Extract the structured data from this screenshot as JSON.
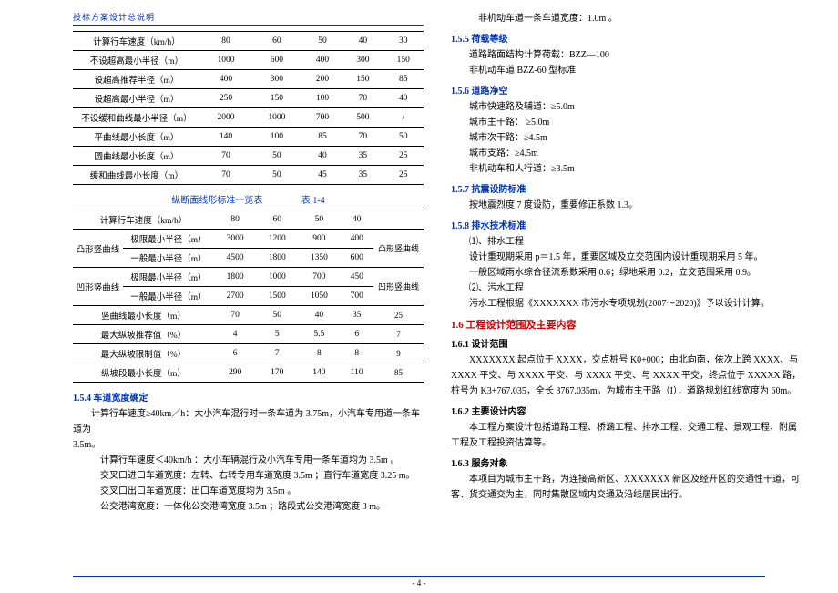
{
  "header": "投标方案设计总说明",
  "table1": {
    "rows": [
      {
        "label": "计算行车速度（km/h）",
        "c": [
          "80",
          "60",
          "50",
          "40",
          "30"
        ]
      },
      {
        "label": "不设超高最小半径（m）",
        "c": [
          "1000",
          "600",
          "400",
          "300",
          "150"
        ]
      },
      {
        "label": "设超高推荐半径（m）",
        "c": [
          "400",
          "300",
          "200",
          "150",
          "85"
        ]
      },
      {
        "label": "设超高最小半径（m）",
        "c": [
          "250",
          "150",
          "100",
          "70",
          "40"
        ]
      },
      {
        "label": "不设缓和曲线最小半径（m）",
        "c": [
          "2000",
          "1000",
          "700",
          "500",
          "/"
        ]
      },
      {
        "label": "平曲线最小长度（m）",
        "c": [
          "140",
          "100",
          "85",
          "70",
          "50"
        ]
      },
      {
        "label": "圆曲线最小长度（m）",
        "c": [
          "70",
          "50",
          "40",
          "35",
          "25"
        ]
      },
      {
        "label": "缓和曲线最小长度（m）",
        "c": [
          "70",
          "50",
          "45",
          "35",
          "25"
        ]
      }
    ]
  },
  "table2": {
    "caption": "纵断面线形标准一览表",
    "tnum": "表 1-4",
    "header": {
      "label": "计算行车速度（km/h）",
      "c": [
        "80",
        "60",
        "50",
        "40"
      ],
      "note": ""
    },
    "groups": [
      {
        "glabel": "凸形竖曲线",
        "rows": [
          {
            "label": "极限最小半径（m）",
            "c": [
              "3000",
              "1200",
              "900",
              "400"
            ],
            "note": "凸形竖曲线"
          },
          {
            "label": "一般最小半径（m）",
            "c": [
              "4500",
              "1800",
              "1350",
              "600"
            ],
            "note": ""
          }
        ]
      },
      {
        "glabel": "凹形竖曲线",
        "rows": [
          {
            "label": "极限最小半径（m）",
            "c": [
              "1800",
              "1000",
              "700",
              "450"
            ],
            "note": "凹形竖曲线"
          },
          {
            "label": "一般最小半径（m）",
            "c": [
              "2700",
              "1500",
              "1050",
              "700"
            ],
            "note": ""
          }
        ]
      }
    ],
    "tail": [
      {
        "label": "竖曲线最小长度（m）",
        "c": [
          "70",
          "50",
          "40",
          "35"
        ],
        "note": "25"
      },
      {
        "label": "最大纵坡推荐值（%）",
        "c": [
          "4",
          "5",
          "5.5",
          "6"
        ],
        "note": "7"
      },
      {
        "label": "最大纵坡限制值（%）",
        "c": [
          "6",
          "7",
          "8",
          "8"
        ],
        "note": "9"
      },
      {
        "label": "纵坡段最小长度（m）",
        "c": [
          "290",
          "170",
          "140",
          "110"
        ],
        "note": "85"
      }
    ]
  },
  "s154": {
    "title": "1.5.4 车道宽度确定",
    "p1": "计算行车速度≥40km／h：大小汽车混行时一条车道为 3.75m，小汽车专用道一条车道为",
    "p1b": "3.5m。",
    "p2": "计算行车速度＜40km/h ：大小车辆混行及小汽车专用一条车道均为 3.5m 。",
    "p3": "交叉口进口车道宽度：左转、右转专用车道宽度 3.5m ；直行车道宽度 3.25 m。",
    "p4": "交叉口出口车道宽度：出口车道宽度均为 3.5m 。",
    "p5": "公交港湾宽度：一体化公交港湾宽度 3.5m ；路段式公交港湾宽度 3 m。",
    "p6": "非机动车道一条车道宽度：1.0m 。"
  },
  "s155": {
    "title": "1.5.5 荷载等级",
    "p1": "道路路面结构计算荷载：BZZ—100",
    "p2": "非机动车道 BZZ-60 型标准"
  },
  "s156": {
    "title": "1.5.6 道路净空",
    "p1": "城市快速路及辅道：≥5.0m",
    "p2": "城市主干路：    ≥5.0m",
    "p3": "城市次干路：≥4.5m",
    "p4": "城市支路：≥4.5m",
    "p5": "非机动车和人行道：≥3.5m"
  },
  "s157": {
    "title": "1.5.7 抗震设防标准",
    "p1": "按地震烈度 7 度设防，重要修正系数 1.3。"
  },
  "s158": {
    "title": "1.5.8 排水技术标准",
    "p1": "⑴、排水工程",
    "p2": "设计重现期采用 p＝1.5 年，重要区域及立交范围内设计重现期采用 5 年。",
    "p3": "一般区域雨水综合径流系数采用 0.6；绿地采用 0.2，立交范围采用 0.9。",
    "p4": "⑵、污水工程",
    "p5": "污水工程根据《XXXXXXX 市污水专项规划(2007～2020)》予以设计计算。"
  },
  "s16": {
    "title": "1.6 工程设计范围及主要内容"
  },
  "s161": {
    "title": "1.6.1 设计范围",
    "p1": "XXXXXXX 起点位于 XXXX，交点桩号 K0+000；由北向南，依次上跨 XXXX、与 XXXX 平交、与 XXXX 平交、与 XXXX 平交、与 XXXX 平交，终点位于 XXXXX 路，桩号为 K3+767.035，全长 3767.035m。为城市主干路（I），道路规划红线宽度为 60m。"
  },
  "s162": {
    "title": "1.6.2 主要设计内容",
    "p1": "本工程方案设计包括道路工程、桥涵工程、排水工程、交通工程、景观工程、附属工程及工程投资估算等。"
  },
  "s163": {
    "title": "1.6.3 服务对象",
    "p1": "本项目为城市主干路，为连接高新区、XXXXXXX 新区及经开区的交通性干道，可客、货交通交为主，同时集散区域内交通及沿线居民出行。"
  },
  "footer": "- 4 -"
}
